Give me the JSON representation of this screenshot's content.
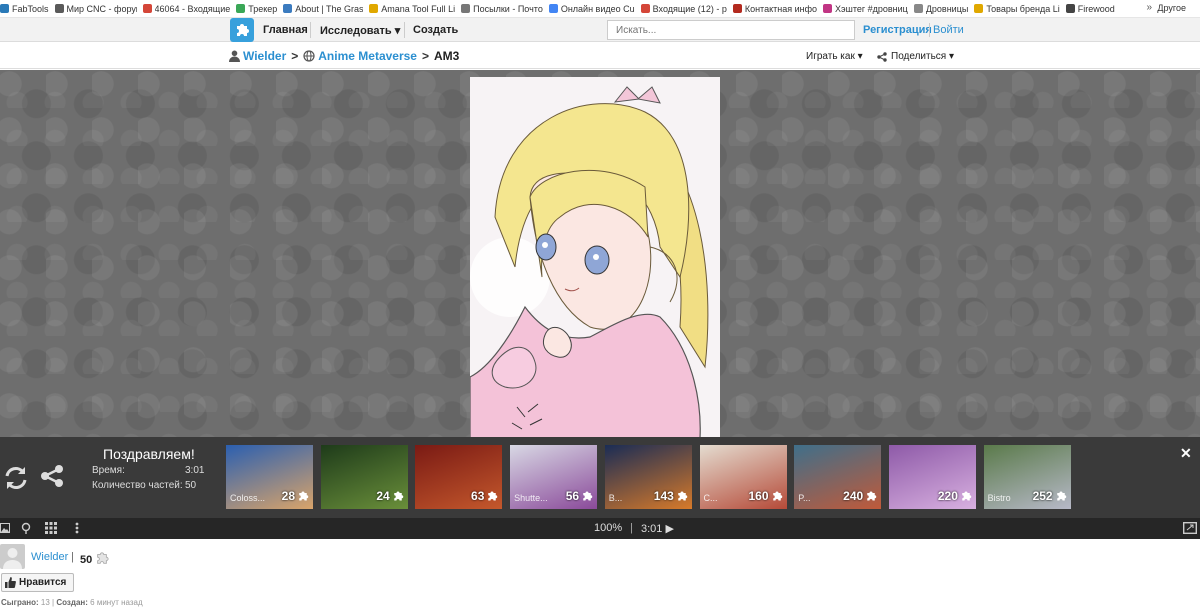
{
  "bookmarks": [
    {
      "label": "FabTools",
      "color": "#2a7ab8"
    },
    {
      "label": "Мир CNC - форум",
      "color": "#5a5a5a"
    },
    {
      "label": "46064 - Входящие",
      "color": "#d44638"
    },
    {
      "label": "Трекер",
      "color": "#3aa757"
    },
    {
      "label": "About | The Grass",
      "color": "#3b7bbf"
    },
    {
      "label": "Amana Tool Full Li",
      "color": "#e0a800"
    },
    {
      "label": "Посылки - Почто",
      "color": "#777777"
    },
    {
      "label": "Онлайн видео Cu",
      "color": "#4285f4"
    },
    {
      "label": "Входящие (12) - р",
      "color": "#d44638"
    },
    {
      "label": "Контактная инфо",
      "color": "#b32a1f"
    },
    {
      "label": "Хэштег #дровниц",
      "color": "#c13584"
    },
    {
      "label": "Дровницы",
      "color": "#888888"
    },
    {
      "label": "Товары бренда Li",
      "color": "#e0a800"
    },
    {
      "label": "Firewood",
      "color": "#444444"
    }
  ],
  "bookmarks_other": "Другое",
  "nav": {
    "home": "Главная",
    "explore": "Исследовать",
    "create": "Создать"
  },
  "search": {
    "placeholder": "Искать..."
  },
  "auth": {
    "register": "Регистрация",
    "login": "Войти"
  },
  "breadcrumb": {
    "user": "Wielder",
    "group": "Anime Metaverse",
    "title": "AM3"
  },
  "actions": {
    "play_as": "Играть как",
    "share": "Поделиться"
  },
  "completion": {
    "title": "Поздравляем!",
    "time_label": "Время:",
    "time_value": "3:01",
    "pieces_label": "Количество частей:",
    "pieces_value": "50"
  },
  "suggestions": [
    {
      "name": "Coloss...",
      "count": "28",
      "colors": [
        "#2b5fb0",
        "#d9a46a"
      ]
    },
    {
      "name": "",
      "count": "24",
      "colors": [
        "#1e3b1a",
        "#6a8f3a"
      ]
    },
    {
      "name": "",
      "count": "63",
      "colors": [
        "#7a1a14",
        "#c4582c"
      ]
    },
    {
      "name": "Shutte...",
      "count": "56",
      "colors": [
        "#d8d8e4",
        "#8a4a9a"
      ]
    },
    {
      "name": "B...",
      "count": "143",
      "colors": [
        "#1a2c55",
        "#d77a2a"
      ]
    },
    {
      "name": "C...",
      "count": "160",
      "colors": [
        "#e4dcd0",
        "#b54a38"
      ]
    },
    {
      "name": "P...",
      "count": "240",
      "colors": [
        "#3f6f8a",
        "#c05a3a"
      ]
    },
    {
      "name": "",
      "count": "220",
      "colors": [
        "#8e5aa8",
        "#d8b0e0"
      ]
    },
    {
      "name": "Bistro",
      "count": "252",
      "colors": [
        "#5a7a4a",
        "#b7b9c8"
      ]
    }
  ],
  "status": {
    "zoom": "100%",
    "timer": "3:01"
  },
  "author": {
    "name": "Wielder",
    "points": "50"
  },
  "like_label": "Нравится",
  "meta": {
    "played_label": "Сыграно:",
    "played_value": "13",
    "created_label": "Создан:",
    "created_value": "6 минут назад"
  },
  "colors": {
    "accent": "#2b8fd0",
    "logo": "#37a0dc",
    "panel": "#3a3a3a",
    "bar": "#262626"
  }
}
